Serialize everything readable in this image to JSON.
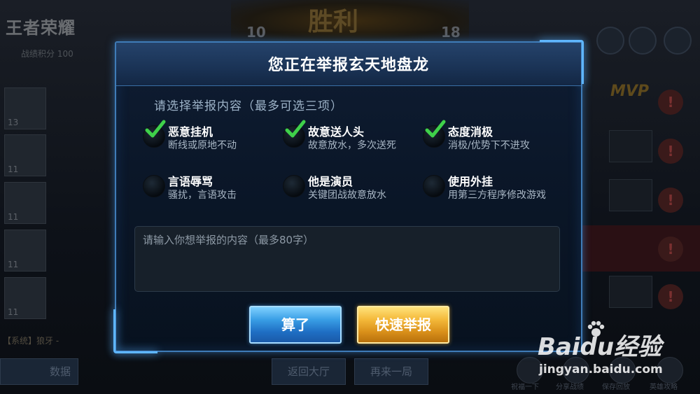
{
  "background": {
    "logo": "王者荣耀",
    "score_left": "10",
    "score_right": "18",
    "victory": "胜利",
    "sub_stat": "战绩积分 100",
    "mvp": "MVP",
    "chat_tag": "系统",
    "chat_text": "【系统】狼牙 -",
    "data_button": "数据",
    "back_lobby": "返回大厅",
    "again": "再来一局",
    "bottom_icons": [
      "祝福一下",
      "分享战绩",
      "保存回放",
      "英雄攻略"
    ]
  },
  "dialog": {
    "title": "您正在举报玄天地盘龙",
    "section_label": "请选择举报内容（最多可选三项）",
    "options": [
      {
        "title": "恶意挂机",
        "desc": "断线或原地不动",
        "checked": true
      },
      {
        "title": "故意送人头",
        "desc": "故意放水，多次送死",
        "checked": true
      },
      {
        "title": "态度消极",
        "desc": "消极/优势下不进攻",
        "checked": true
      },
      {
        "title": "言语辱骂",
        "desc": "骚扰，言语攻击",
        "checked": false
      },
      {
        "title": "他是演员",
        "desc": "关键团战故意放水",
        "checked": false
      },
      {
        "title": "使用外挂",
        "desc": "用第三方程序修改游戏",
        "checked": false
      }
    ],
    "input_placeholder": "请输入你想举报的内容（最多80字）",
    "cancel_label": "算了",
    "report_label": "快速举报"
  },
  "watermark": {
    "brand": "Baidu经验",
    "url": "jingyan.baidu.com"
  },
  "colors": {
    "accent_blue": "#3f7cb8",
    "check_green": "#3fd14a",
    "report_gold": "#f4b93a",
    "cancel_blue": "#3a9fe6"
  }
}
